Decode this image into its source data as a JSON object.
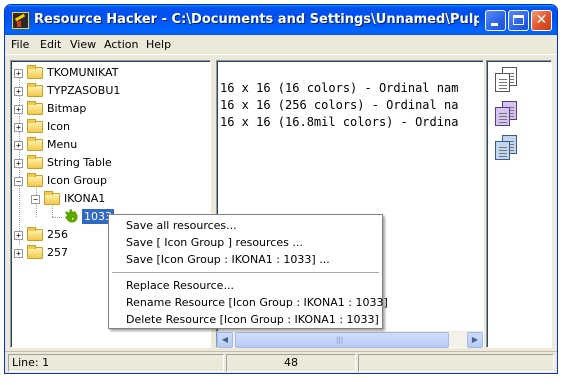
{
  "window": {
    "title": "Resource Hacker  -  C:\\Documents and Settings\\Unnamed\\Pulpit\\Przy..."
  },
  "menubar": {
    "items": [
      "File",
      "Edit",
      "View",
      "Action",
      "Help"
    ]
  },
  "tree": {
    "items": [
      {
        "label": "TKOMUNIKAT",
        "expander": "+"
      },
      {
        "label": "TYPZASOBU1",
        "expander": "+"
      },
      {
        "label": "Bitmap",
        "expander": "+"
      },
      {
        "label": "Icon",
        "expander": "+"
      },
      {
        "label": "Menu",
        "expander": "+"
      },
      {
        "label": "String Table",
        "expander": "+"
      },
      {
        "label": "Icon Group",
        "expander": "−"
      },
      {
        "label": "IKONA1",
        "expander": "−"
      },
      {
        "label": "1033"
      },
      {
        "label": "256",
        "expander": "+"
      },
      {
        "label": "257",
        "expander": "+"
      }
    ],
    "selected_label": "1033"
  },
  "code_view": {
    "lines": [
      "16 x 16 (16 colors) - Ordinal nam",
      "16 x 16 (256 colors) - Ordinal na",
      "16 x 16 (16.8mil colors) - Ordina"
    ]
  },
  "icon_strip": {
    "icons": [
      "icon-image-gray",
      "icon-image-purple",
      "icon-image-blue"
    ]
  },
  "context_menu": {
    "items": [
      "Save all resources...",
      "Save [ Icon Group ] resources ...",
      "Save [Icon Group : IKONA1 : 1033] ...",
      "Replace Resource...",
      "Rename Resource [Icon Group : IKONA1 : 1033]",
      "Delete Resource [Icon Group : IKONA1 : 1033]"
    ]
  },
  "statusbar": {
    "line": "Line: 1",
    "count": "48"
  },
  "colors": {
    "titlebar": "#0054E3",
    "selection": "#316AC5",
    "window_bg": "#ECE9D8"
  }
}
